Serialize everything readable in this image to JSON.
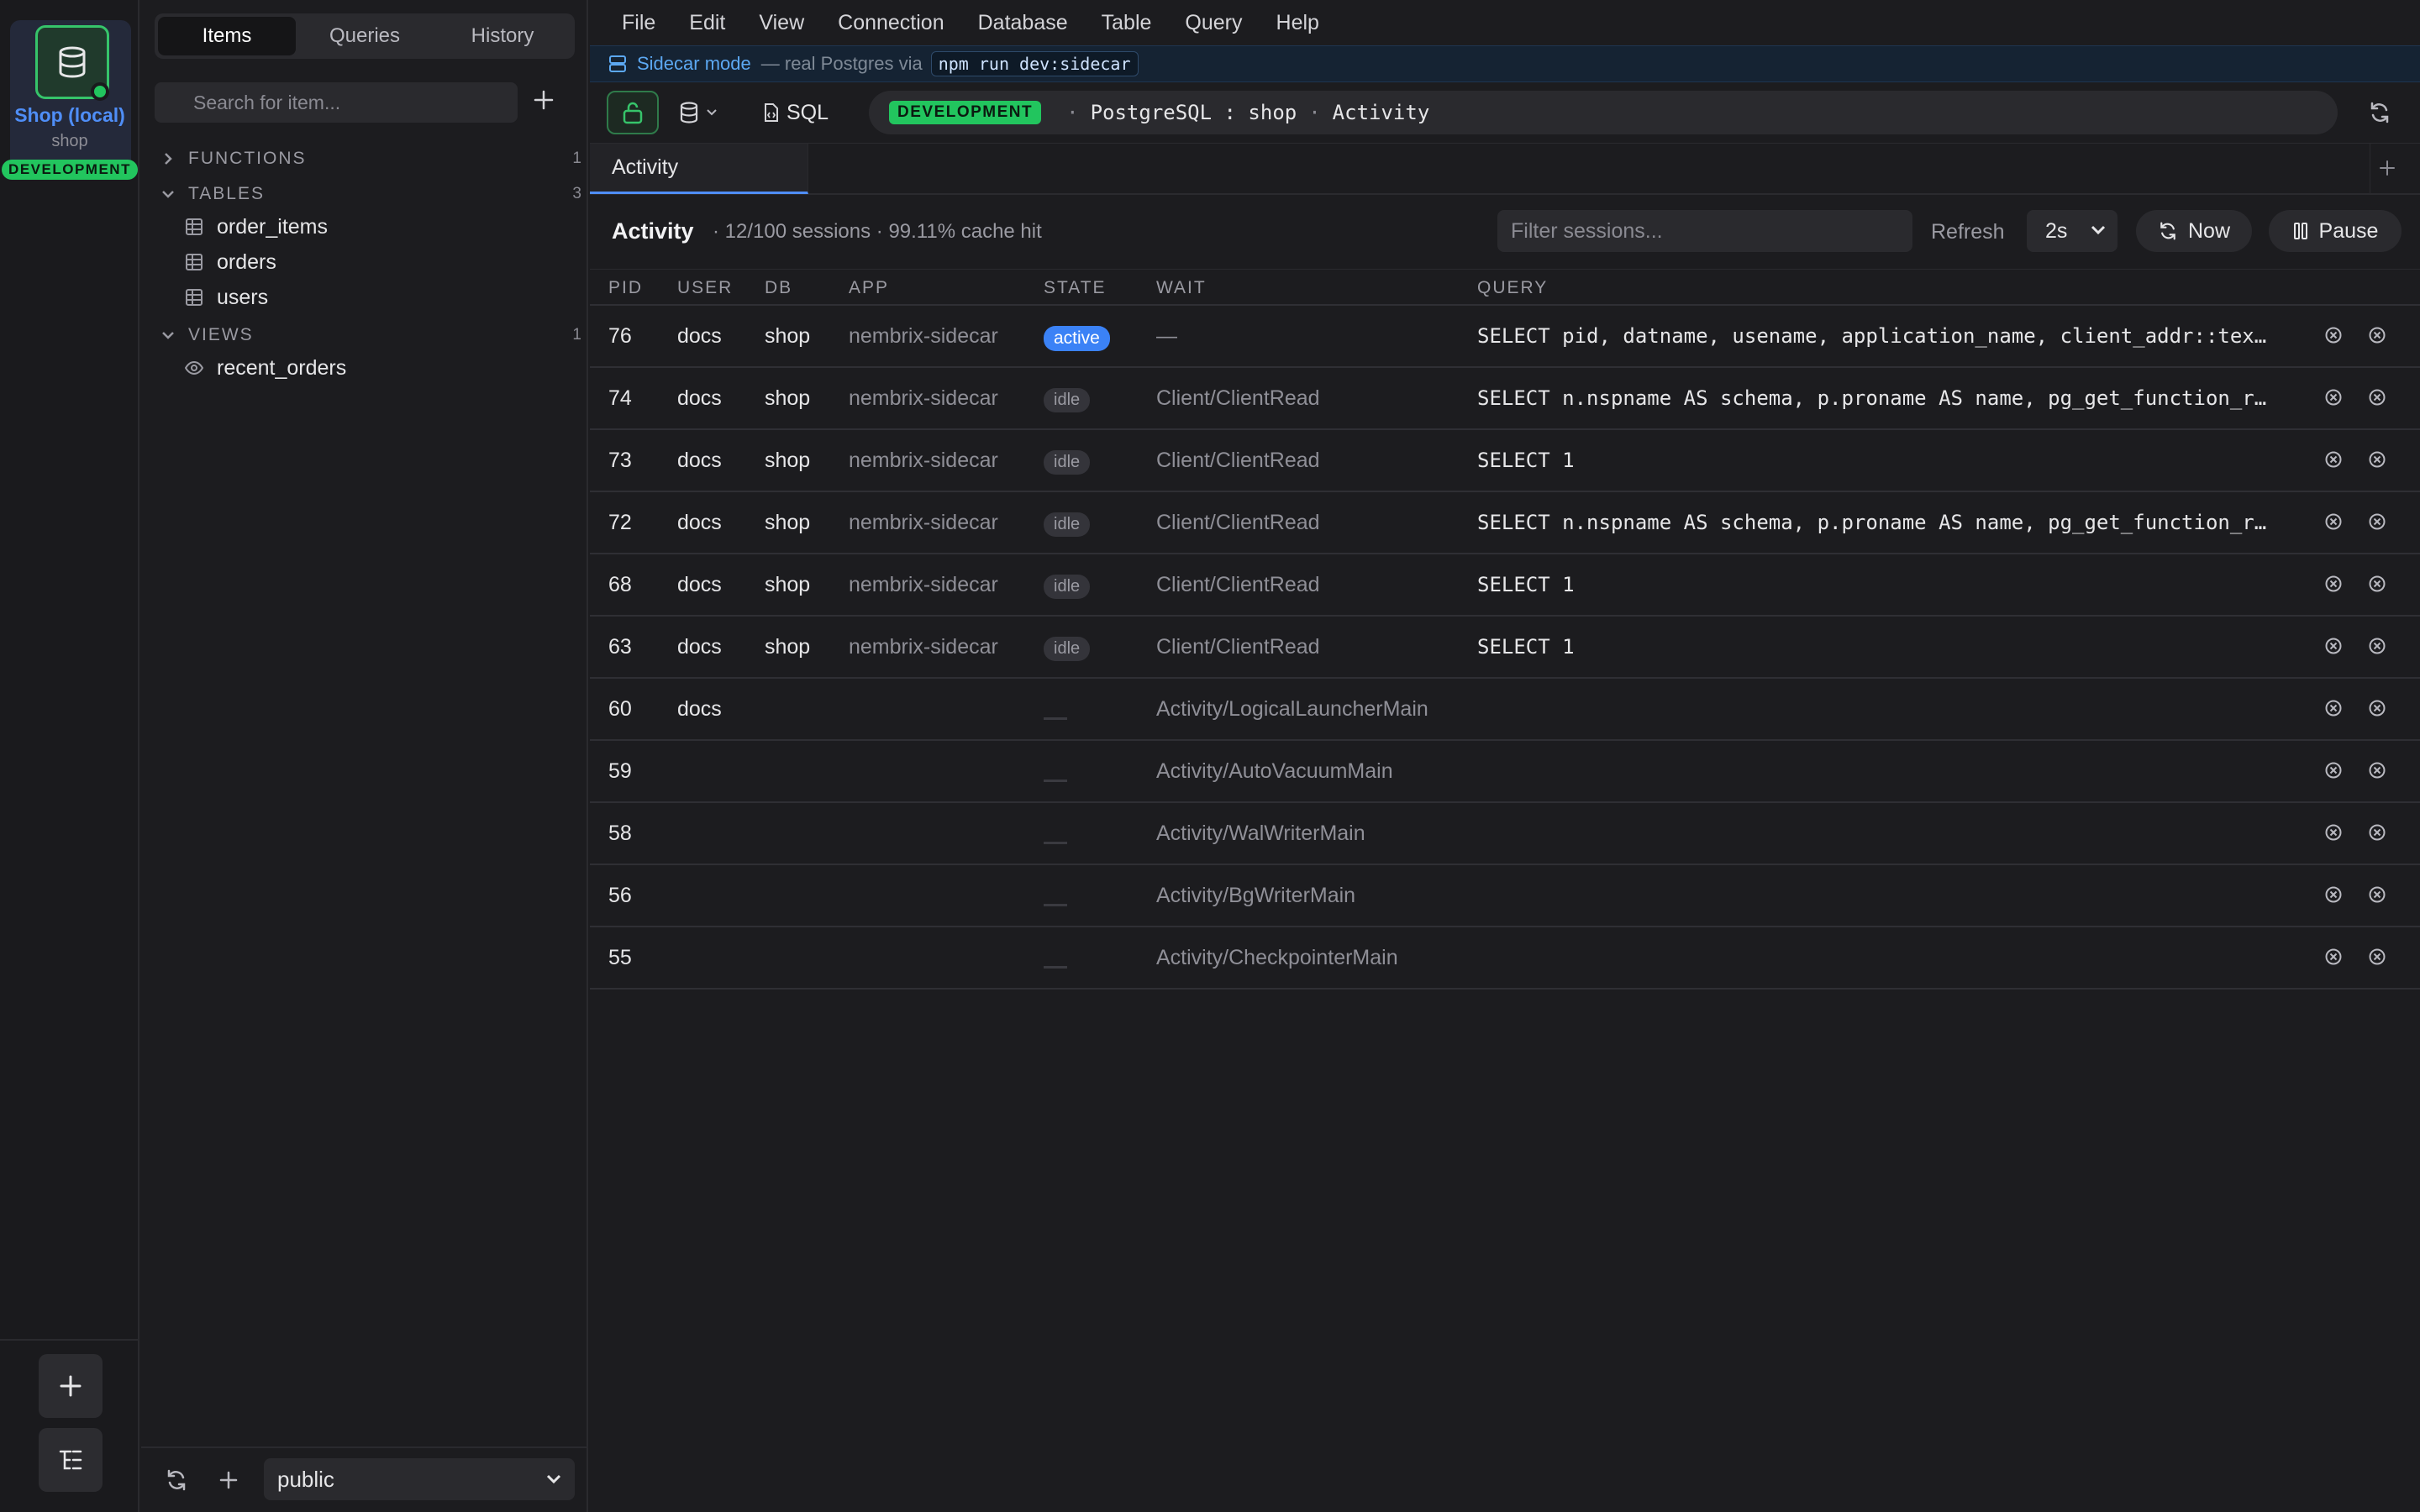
{
  "connection": {
    "name": "Shop (local)",
    "database": "shop",
    "environment": "DEVELOPMENT",
    "icon": "database-icon"
  },
  "sidebar": {
    "tabs": [
      "Items",
      "Queries",
      "History"
    ],
    "active_tab": "Items",
    "search_placeholder": "Search for item...",
    "groups": [
      {
        "name": "FUNCTIONS",
        "count": "1",
        "expanded": false,
        "items": []
      },
      {
        "name": "TABLES",
        "count": "3",
        "expanded": true,
        "items": [
          "order_items",
          "orders",
          "users"
        ]
      },
      {
        "name": "VIEWS",
        "count": "1",
        "expanded": true,
        "items": [
          "recent_orders"
        ]
      }
    ],
    "schema": "public"
  },
  "menu": [
    "File",
    "Edit",
    "View",
    "Connection",
    "Database",
    "Table",
    "Query",
    "Help"
  ],
  "banner": {
    "title": "Sidecar mode",
    "subtitle": "— real Postgres via",
    "command": "npm run dev:sidecar"
  },
  "toolbar": {
    "sql_label": "SQL",
    "env_badge": "DEVELOPMENT",
    "engine": "PostgreSQL : shop",
    "location": "Activity"
  },
  "tabs": [
    {
      "label": "Activity",
      "active": true
    }
  ],
  "activity": {
    "title": "Activity",
    "stats": "· 12/100 sessions · 99.11% cache hit",
    "filter_placeholder": "Filter sessions...",
    "refresh_label": "Refresh",
    "interval": "2s",
    "now_label": "Now",
    "pause_label": "Pause",
    "columns": [
      "PID",
      "USER",
      "DB",
      "APP",
      "STATE",
      "WAIT",
      "QUERY"
    ],
    "rows": [
      {
        "pid": "76",
        "user": "docs",
        "db": "shop",
        "app": "nembrix-sidecar",
        "state": "active",
        "wait": "—",
        "query": "SELECT pid, datname, usename, application_name, client_addr::tex…"
      },
      {
        "pid": "74",
        "user": "docs",
        "db": "shop",
        "app": "nembrix-sidecar",
        "state": "idle",
        "wait": "Client/ClientRead",
        "query": "SELECT n.nspname AS schema, p.proname AS name, pg_get_function_r…"
      },
      {
        "pid": "73",
        "user": "docs",
        "db": "shop",
        "app": "nembrix-sidecar",
        "state": "idle",
        "wait": "Client/ClientRead",
        "query": "SELECT 1"
      },
      {
        "pid": "72",
        "user": "docs",
        "db": "shop",
        "app": "nembrix-sidecar",
        "state": "idle",
        "wait": "Client/ClientRead",
        "query": "SELECT n.nspname AS schema, p.proname AS name, pg_get_function_r…"
      },
      {
        "pid": "68",
        "user": "docs",
        "db": "shop",
        "app": "nembrix-sidecar",
        "state": "idle",
        "wait": "Client/ClientRead",
        "query": "SELECT 1"
      },
      {
        "pid": "63",
        "user": "docs",
        "db": "shop",
        "app": "nembrix-sidecar",
        "state": "idle",
        "wait": "Client/ClientRead",
        "query": "SELECT 1"
      },
      {
        "pid": "60",
        "user": "docs",
        "db": "",
        "app": "",
        "state": "",
        "wait": "Activity/LogicalLauncherMain",
        "query": ""
      },
      {
        "pid": "59",
        "user": "",
        "db": "",
        "app": "",
        "state": "",
        "wait": "Activity/AutoVacuumMain",
        "query": ""
      },
      {
        "pid": "58",
        "user": "",
        "db": "",
        "app": "",
        "state": "",
        "wait": "Activity/WalWriterMain",
        "query": ""
      },
      {
        "pid": "56",
        "user": "",
        "db": "",
        "app": "",
        "state": "",
        "wait": "Activity/BgWriterMain",
        "query": ""
      },
      {
        "pid": "55",
        "user": "",
        "db": "",
        "app": "",
        "state": "",
        "wait": "Activity/CheckpointerMain",
        "query": ""
      }
    ]
  },
  "colors": {
    "accent": "#4f8ef7",
    "env_green": "#22c55e",
    "active_badge": "#3b82f6"
  }
}
